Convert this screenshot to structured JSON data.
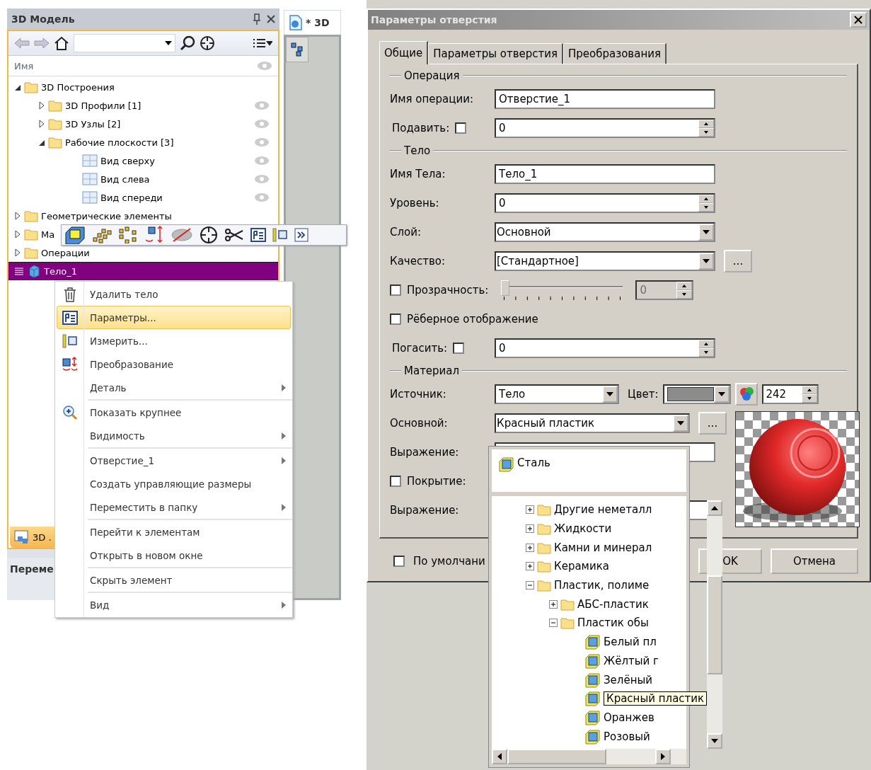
{
  "left_panel": {
    "title": "3D Модель",
    "column_header": "Имя",
    "tree": [
      {
        "label": "3D Построения",
        "kind": "folder",
        "expanded": true,
        "selected": false,
        "children": [
          {
            "label": "3D Профили [1]",
            "kind": "folder",
            "expanded": false,
            "selected": false
          },
          {
            "label": "3D Узлы [2]",
            "kind": "folder",
            "expanded": false,
            "selected": false
          },
          {
            "label": "Рабочие плоскости [3]",
            "kind": "folder",
            "expanded": true,
            "selected": false,
            "children": [
              {
                "label": "Вид сверху",
                "kind": "plane",
                "selected": false
              },
              {
                "label": "Вид слева",
                "kind": "plane",
                "selected": false
              },
              {
                "label": "Вид спереди",
                "kind": "plane",
                "selected": false
              }
            ]
          }
        ]
      },
      {
        "label": "Геометрические элементы",
        "kind": "folder",
        "expanded": false,
        "selected": false
      },
      {
        "label": "Ма",
        "kind": "folder",
        "expanded": false,
        "selected": false
      },
      {
        "label": "Операции",
        "kind": "folder",
        "expanded": false,
        "selected": false
      },
      {
        "label": "Тело_1",
        "kind": "body",
        "selected": true
      }
    ],
    "bottom_tab": "3D .",
    "bottom_header": "Переме"
  },
  "document_tab": {
    "title": "* 3D"
  },
  "context_menu": {
    "groups": [
      [
        {
          "label": "Удалить тело",
          "kind": "trash",
          "selected": false,
          "submenu": false
        },
        {
          "label": "Параметры...",
          "kind": "params",
          "selected": true,
          "submenu": false
        },
        {
          "label": "Измерить...",
          "kind": "measure",
          "selected": false,
          "submenu": false
        },
        {
          "label": "Преобразование",
          "kind": "transform",
          "selected": false,
          "submenu": false
        },
        {
          "label": "Деталь",
          "kind": "plain",
          "selected": false,
          "submenu": true
        }
      ],
      [
        {
          "label": "Показать крупнее",
          "kind": "zoom",
          "selected": false,
          "submenu": false
        },
        {
          "label": "Видимость",
          "kind": "plain",
          "selected": false,
          "submenu": true
        }
      ],
      [
        {
          "label": "Отверстие_1",
          "kind": "plain",
          "selected": false,
          "submenu": true
        },
        {
          "label": "Создать управляющие размеры",
          "kind": "plain",
          "selected": false,
          "submenu": false
        },
        {
          "label": "Переместить в папку",
          "kind": "plain",
          "selected": false,
          "submenu": true
        }
      ],
      [
        {
          "label": "Перейти к элементам",
          "kind": "plain",
          "selected": false,
          "submenu": false
        },
        {
          "label": "Открыть в новом окне",
          "kind": "plain",
          "selected": false,
          "submenu": false
        }
      ],
      [
        {
          "label": "Скрыть элемент",
          "kind": "plain",
          "selected": false,
          "submenu": false
        }
      ],
      [
        {
          "label": "Вид",
          "kind": "plain",
          "selected": false,
          "submenu": true
        }
      ]
    ]
  },
  "dialog": {
    "title": "Параметры отверстия",
    "tabs": [
      {
        "label": "Общие",
        "selected": true
      },
      {
        "label": "Параметры отверстия",
        "selected": false
      },
      {
        "label": "Преобразования",
        "selected": false
      }
    ],
    "sections": [
      {
        "title": "Операция",
        "rows": [
          {
            "kind": "text",
            "label": "Имя операции:",
            "value": "Отверстие_1"
          },
          {
            "kind": "check_spin",
            "label": "Подавить:",
            "checked": false,
            "value": "0"
          }
        ]
      },
      {
        "title": "Тело",
        "rows": [
          {
            "kind": "text",
            "label": "Имя Тела:",
            "value": "Тело_1"
          },
          {
            "kind": "spin",
            "label": "Уровень:",
            "value": "0"
          },
          {
            "kind": "combo",
            "label": "Слой:",
            "value": "Основной"
          },
          {
            "kind": "combo_more",
            "label": "Качество:",
            "value": "[Стандартное]",
            "button": "..."
          },
          {
            "kind": "slider",
            "label": "Прозрачность:",
            "checked": false,
            "level": 0,
            "value": "0",
            "disabled": true
          },
          {
            "kind": "check",
            "label": "Рёберное отображение",
            "checked": false
          },
          {
            "kind": "check_spin",
            "label": "Погасить:",
            "checked": false,
            "value": "0"
          }
        ]
      }
    ],
    "material": {
      "title": "Материал",
      "source_label": "Источник:",
      "source": "Тело",
      "color_label": "Цвет:",
      "color": "#8c8c8c",
      "color_number": "242",
      "main_label": "Основной:",
      "main": "Красный пластик",
      "more": "...",
      "expression_label": "Выражение:",
      "coating_label": "Покрытие:",
      "coating_checked": false,
      "expression2_label": "Выражение:"
    },
    "default_check": {
      "label": "По умолчани",
      "checked": false
    },
    "buttons": [
      "OK",
      "Отмена"
    ]
  },
  "material_dropdown": {
    "current": "Сталь",
    "tree": [
      {
        "label": "Другие неметалл",
        "kind": "folder",
        "expanded": false
      },
      {
        "label": "Жидкости",
        "kind": "folder",
        "expanded": false
      },
      {
        "label": "Камни и минерал",
        "kind": "folder",
        "expanded": false
      },
      {
        "label": "Керамика",
        "kind": "folder",
        "expanded": false
      },
      {
        "label": "Пластик, полиме",
        "kind": "folder",
        "expanded": true,
        "children": [
          {
            "label": "АБС-пластик",
            "kind": "folder",
            "expanded": false
          },
          {
            "label": "Пластик обы",
            "kind": "folder",
            "expanded": true,
            "children": [
              {
                "label": "Белый пл",
                "kind": "material",
                "hovered": false
              },
              {
                "label": "Жёлтый г",
                "kind": "material",
                "hovered": false
              },
              {
                "label": "Зелёный",
                "kind": "material",
                "hovered": false
              },
              {
                "label": "Красный пластик",
                "kind": "material",
                "hovered": true
              },
              {
                "label": "Оранжев",
                "kind": "material",
                "hovered": false
              },
              {
                "label": "Розовый",
                "kind": "material",
                "hovered": false
              }
            ]
          }
        ]
      }
    ]
  }
}
